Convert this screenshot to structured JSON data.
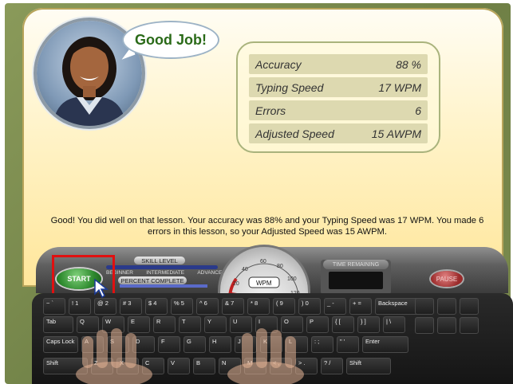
{
  "bubble": {
    "text": "Good Job!"
  },
  "stats": [
    {
      "label": "Accuracy",
      "value": "88 %"
    },
    {
      "label": "Typing Speed",
      "value": "17 WPM"
    },
    {
      "label": "Errors",
      "value": "6"
    },
    {
      "label": "Adjusted Speed",
      "value": "15 AWPM"
    }
  ],
  "message": "Good!  You did well on that lesson.  Your accuracy was 88% and your Typing Speed was 17 WPM.  You made 6 errors in this lesson, so your Adjusted Speed was 15 AWPM.",
  "controls": {
    "start_label": "START",
    "skill_level_label": "SKILL LEVEL",
    "levels": [
      "BEGINNER",
      "INTERMEDIATE",
      "ADVANCED"
    ],
    "percent_complete_label": "PERCENT COMPLETE",
    "time_remaining_label": "TIME REMAINING",
    "pause_label": "PAUSE"
  },
  "gauge": {
    "unit": "WPM",
    "ticks": [
      "20",
      "40",
      "60",
      "80",
      "100",
      "120"
    ]
  },
  "keyboard": {
    "row1": [
      "~ `",
      "! 1",
      "@ 2",
      "# 3",
      "$ 4",
      "% 5",
      "^ 6",
      "& 7",
      "* 8",
      "( 9",
      ") 0",
      "_ -",
      "+ =",
      "Backspace"
    ],
    "row2": [
      "Tab",
      "Q",
      "W",
      "E",
      "R",
      "T",
      "Y",
      "U",
      "I",
      "O",
      "P",
      "{ [",
      "} ]",
      "| \\"
    ],
    "row3": [
      "Caps Lock",
      "A",
      "S",
      "D",
      "F",
      "G",
      "H",
      "J",
      "K",
      "L",
      ": ;",
      "\" '",
      "Enter"
    ],
    "row4": [
      "Shift",
      "Z",
      "X",
      "C",
      "V",
      "B",
      "N",
      "M",
      "< ,",
      "> .",
      "? /",
      "Shift"
    ]
  },
  "colors": {
    "highlight": "#e01010",
    "start_green": "#2e8a2e",
    "panel_yellow": "#ffe69a"
  }
}
